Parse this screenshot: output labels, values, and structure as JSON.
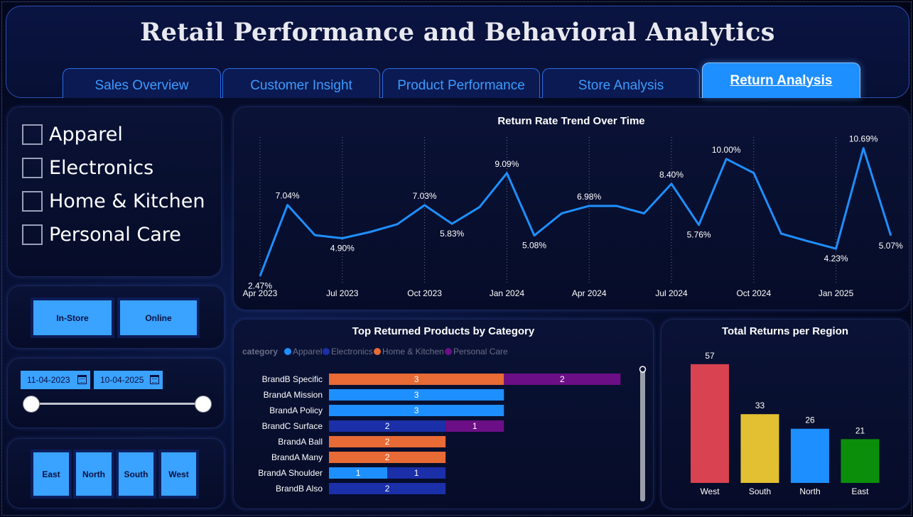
{
  "header": {
    "title": "Retail Performance and Behavioral Analytics"
  },
  "tabs": [
    {
      "label": "Sales Overview",
      "active": false
    },
    {
      "label": "Customer Insight",
      "active": false
    },
    {
      "label": "Product Performance",
      "active": false
    },
    {
      "label": "Store Analysis",
      "active": false
    },
    {
      "label": "Return Analysis",
      "active": true
    }
  ],
  "category_filter": {
    "items": [
      {
        "label": "Apparel",
        "checked": false
      },
      {
        "label": "Electronics",
        "checked": false
      },
      {
        "label": "Home & Kitchen",
        "checked": false
      },
      {
        "label": "Personal Care",
        "checked": false
      }
    ]
  },
  "channel_filter": {
    "options": [
      "In-Store",
      "Online"
    ]
  },
  "date_filter": {
    "start": "11-04-2023",
    "end": "10-04-2025"
  },
  "region_filter": {
    "options": [
      "East",
      "North",
      "South",
      "West"
    ]
  },
  "colors": {
    "accent": "#1e8fff",
    "apparel": "#1e8fff",
    "electronics": "#1a2fa8",
    "home_kitchen": "#e86a35",
    "personal_care": "#6c0f86",
    "west": "#d94250",
    "south": "#e2c032",
    "north": "#1e8fff",
    "east": "#0b8f0b"
  },
  "chart_data": [
    {
      "type": "line",
      "title": "Return Rate Trend Over Time",
      "x_tick_labels": [
        "Apr 2023",
        "Jul 2023",
        "Oct 2023",
        "Jan 2024",
        "Apr 2024",
        "Jul 2024",
        "Oct 2024",
        "Jan 2025"
      ],
      "x": [
        "2023-04",
        "2023-05",
        "2023-06",
        "2023-07",
        "2023-08",
        "2023-09",
        "2023-10",
        "2023-11",
        "2023-12",
        "2024-01",
        "2024-02",
        "2024-03",
        "2024-04",
        "2024-05",
        "2024-06",
        "2024-07",
        "2024-08",
        "2024-09",
        "2024-10",
        "2024-11",
        "2024-12",
        "2025-01",
        "2025-02",
        "2025-03"
      ],
      "values": [
        2.47,
        7.04,
        5.1,
        4.9,
        5.3,
        5.8,
        7.03,
        5.83,
        6.9,
        9.09,
        5.08,
        6.5,
        6.98,
        6.98,
        6.5,
        8.4,
        5.76,
        10.0,
        9.1,
        5.2,
        4.7,
        4.23,
        10.69,
        5.07
      ],
      "data_labels": [
        {
          "index": 0,
          "text": "2.47%"
        },
        {
          "index": 1,
          "text": "7.04%"
        },
        {
          "index": 3,
          "text": "4.90%"
        },
        {
          "index": 6,
          "text": "7.03%"
        },
        {
          "index": 7,
          "text": "5.83%"
        },
        {
          "index": 9,
          "text": "9.09%"
        },
        {
          "index": 10,
          "text": "5.08%"
        },
        {
          "index": 12,
          "text": "6.98%"
        },
        {
          "index": 15,
          "text": "8.40%"
        },
        {
          "index": 16,
          "text": "5.76%"
        },
        {
          "index": 17,
          "text": "10.00%"
        },
        {
          "index": 21,
          "text": "4.23%"
        },
        {
          "index": 22,
          "text": "10.69%"
        },
        {
          "index": 23,
          "text": "5.07%"
        }
      ],
      "color": "#1e8fff",
      "ylim": [
        2,
        11.5
      ]
    },
    {
      "type": "bar",
      "orientation": "horizontal",
      "stacked": true,
      "title": "Top Returned Products by Category",
      "legend_title": "category",
      "legend": [
        "Apparel",
        "Electronics",
        "Home & Kitchen",
        "Personal Care"
      ],
      "categories": [
        "BrandB Specific",
        "BrandA Mission",
        "BrandA Policy",
        "BrandC Surface",
        "BrandA Ball",
        "BrandA Many",
        "BrandA Shoulder",
        "BrandB Also"
      ],
      "series": [
        {
          "name": "Apparel",
          "values": [
            0,
            3,
            3,
            0,
            0,
            0,
            1,
            0
          ]
        },
        {
          "name": "Electronics",
          "values": [
            0,
            0,
            0,
            2,
            0,
            0,
            1,
            2
          ]
        },
        {
          "name": "Home & Kitchen",
          "values": [
            3,
            0,
            0,
            0,
            2,
            2,
            0,
            0
          ]
        },
        {
          "name": "Personal Care",
          "values": [
            2,
            0,
            0,
            1,
            0,
            0,
            0,
            0
          ]
        }
      ],
      "xlim": [
        0,
        5.3
      ]
    },
    {
      "type": "bar",
      "title": "Total Returns per Region",
      "categories": [
        "West",
        "South",
        "North",
        "East"
      ],
      "values": [
        57,
        33,
        26,
        21
      ],
      "ylim": [
        0,
        60
      ]
    }
  ]
}
